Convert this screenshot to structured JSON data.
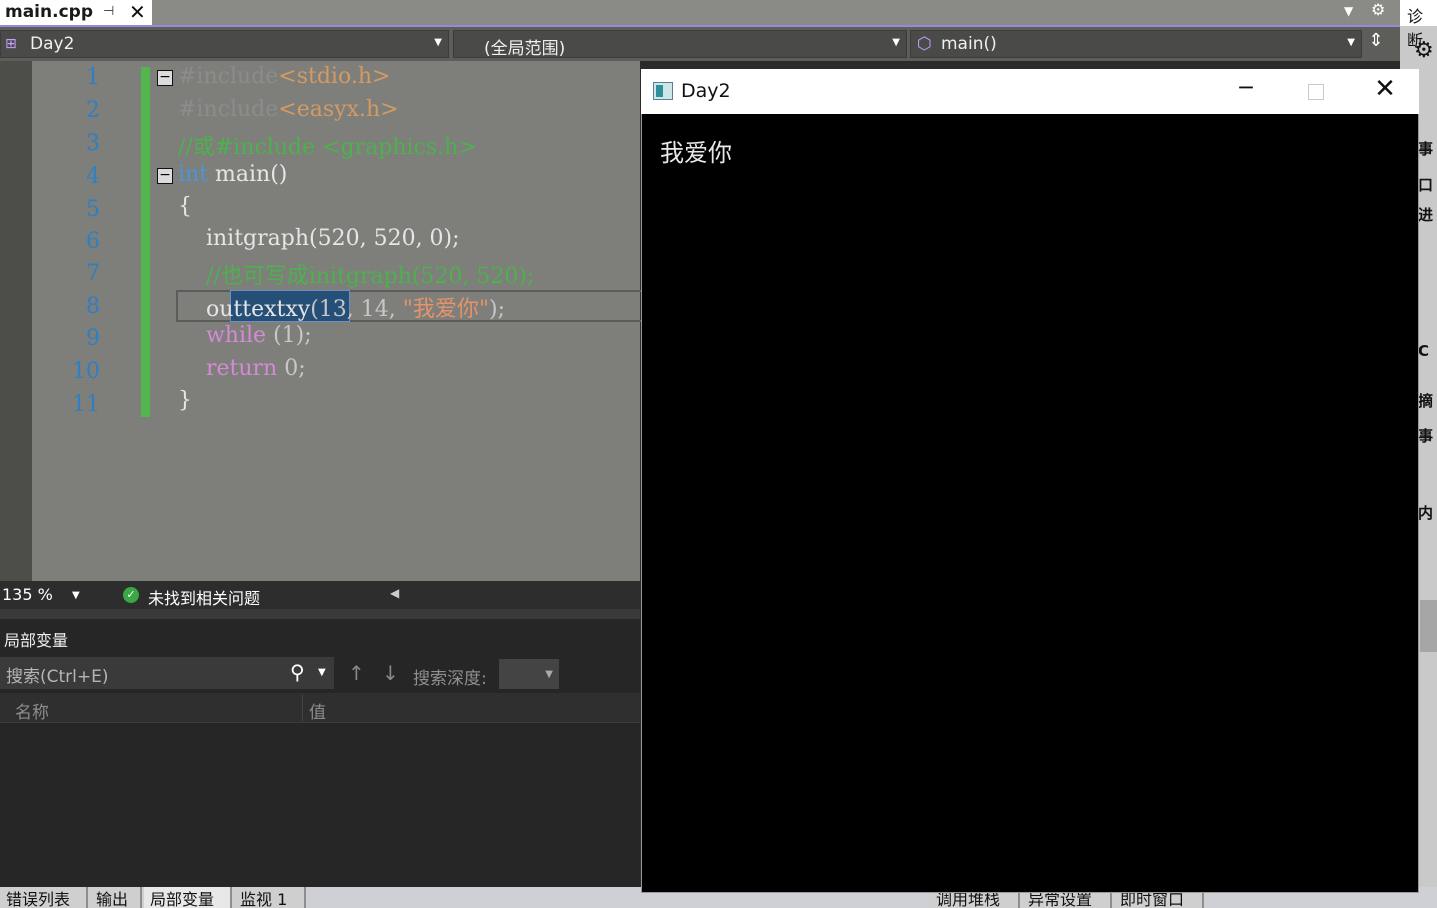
{
  "tab": {
    "file": "main.cpp",
    "pin": "⊣",
    "close": "✕"
  },
  "navbar": {
    "project": "Day2",
    "scope": "(全局范围)",
    "member": "main()"
  },
  "editor": {
    "line_numbers": [
      "1",
      "2",
      "3",
      "4",
      "5",
      "6",
      "7",
      "8",
      "9",
      "10",
      "11"
    ],
    "lines": {
      "l1_pp": "#include",
      "l1_inc": "<stdio.h>",
      "l2_pp": "#include",
      "l2_inc": "<easyx.h>",
      "l3_cm": "//或#include <graphics.h>",
      "l4_kw": "int",
      "l4_tx": " main()",
      "l5_tx": "{",
      "l6_tx": "    initgraph(520, 520, 0);",
      "l7_cm": "    //也可写成initgraph(520, 520);",
      "l8_sel": "outtextxy",
      "l8_tx": "(13, 14, ",
      "l8_str": "\"我爱你\"",
      "l8_end": ");",
      "l9_kw": "    while",
      "l9_tx": " (1);",
      "l10_kw": "    return",
      "l10_tx": " 0;",
      "l11_tx": "}"
    },
    "fold_symbol": "−"
  },
  "status": {
    "zoom": "135 %",
    "issues": "未找到相关问题"
  },
  "locals": {
    "title": "局部变量",
    "search_placeholder": "搜索(Ctrl+E)",
    "depth_label": "搜索深度:",
    "col_name": "名称",
    "col_value": "值"
  },
  "bottom_tabs": [
    "错误列表",
    "输出",
    "局部变量",
    "监视 1",
    "调用堆栈",
    "异常设置",
    "即时窗口"
  ],
  "right_strip": {
    "top": "诊断",
    "items": [
      "事",
      "口",
      "进",
      "C",
      "摘",
      "事",
      "内",
      "内"
    ]
  },
  "console": {
    "title": "Day2",
    "text": "我爱你"
  },
  "colors": {
    "accent": "#9b86d8",
    "changebar": "#53b64c",
    "line_number": "#2e7fc4",
    "selection": "#264f78"
  }
}
